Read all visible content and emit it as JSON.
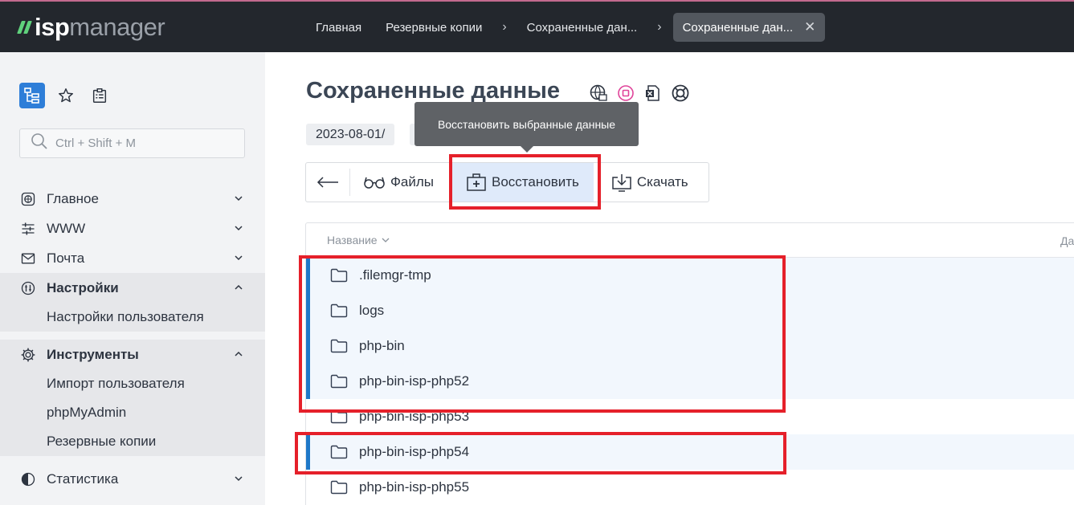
{
  "topbar": {
    "logo_isp": "isp",
    "logo_manager": "manager",
    "breadcrumbs": [
      "Главная",
      "Резервные копии",
      "Сохраненные дан...",
      "Сохраненные дан..."
    ],
    "breadcrumb_separator": "›",
    "close_glyph": "✕"
  },
  "sidebar": {
    "search_placeholder": "Ctrl + Shift + M",
    "menu": [
      {
        "label": "Главное",
        "icon": "globe-settings-icon",
        "expanded": false
      },
      {
        "label": "WWW",
        "icon": "sliders-icon",
        "expanded": false
      },
      {
        "label": "Почта",
        "icon": "mail-icon",
        "expanded": false
      },
      {
        "label": "Настройки",
        "icon": "settings-tools-icon",
        "expanded": true,
        "children": [
          "Настройки пользователя"
        ]
      },
      {
        "label": "Инструменты",
        "icon": "gear-icon",
        "expanded": true,
        "children": [
          "Импорт пользователя",
          "phpMyAdmin",
          "Резервные копии"
        ]
      },
      {
        "label": "Статистика",
        "icon": "pie-chart-icon",
        "expanded": false
      }
    ]
  },
  "main": {
    "title": "Сохраненные данные",
    "path_chip": "2023-08-01/",
    "tooltip": "Восстановить выбранные данные",
    "toolbar": {
      "files_label": "Файлы",
      "restore_label": "Восстановить",
      "download_label": "Скачать"
    },
    "table": {
      "col_name": "Название",
      "col_second": "Да",
      "rows": [
        {
          "name": ".filemgr-tmp",
          "selected": true
        },
        {
          "name": "logs",
          "selected": true
        },
        {
          "name": "php-bin",
          "selected": true
        },
        {
          "name": "php-bin-isp-php52",
          "selected": true
        },
        {
          "name": "php-bin-isp-php53",
          "selected": false
        },
        {
          "name": "php-bin-isp-php54",
          "selected": true
        },
        {
          "name": "php-bin-isp-php55",
          "selected": false
        }
      ]
    }
  },
  "colors": {
    "topbar_bg": "#23272d",
    "accent_blue": "#1f78c8",
    "logo_green": "#5fd17c",
    "highlight_red": "#e5202a",
    "selected_row_bg": "#f2f7fd"
  }
}
